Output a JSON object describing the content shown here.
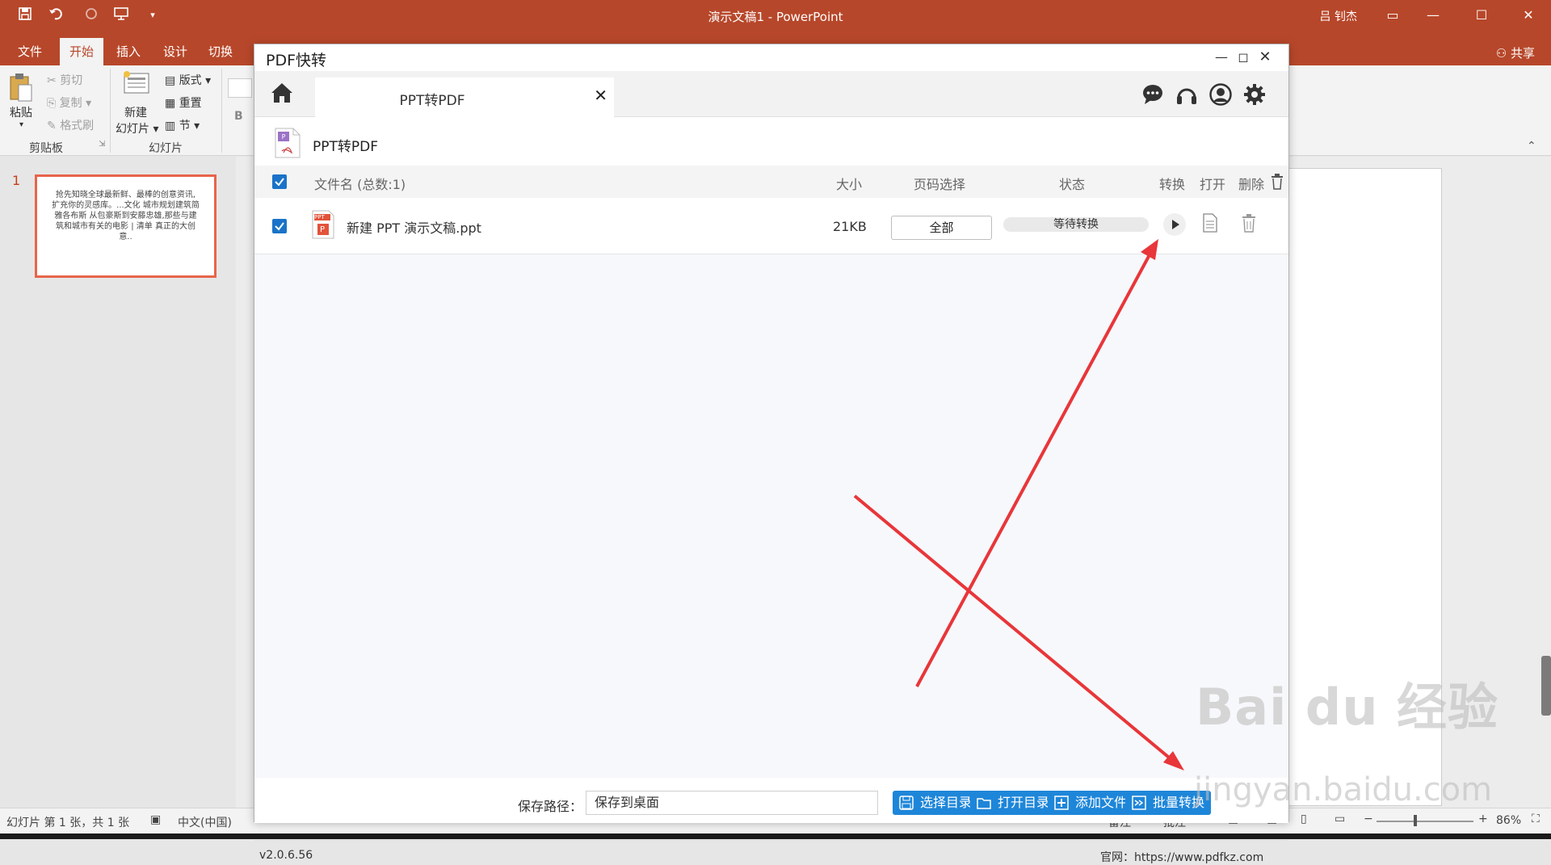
{
  "app": {
    "title": "演示文稿1 - PowerPoint",
    "user": "吕 钊杰",
    "share": "共享",
    "tabs": [
      "文件",
      "开始",
      "插入",
      "设计",
      "切换"
    ],
    "active_tab": "开始"
  },
  "ribbon": {
    "paste": "粘贴",
    "cut": "剪切",
    "copy": "复制",
    "format_painter": "格式刷",
    "clipboard_label": "剪贴板",
    "new_slide_1": "新建",
    "new_slide_2": "幻灯片",
    "layout": "版式",
    "reset": "重置",
    "section": "节",
    "slides_label": "幻灯片",
    "bold": "B"
  },
  "slides": {
    "number": "1",
    "thumb_text": "抢先知晓全球最新鲜、最棒的创意资讯,扩充你的灵感库。...文化 城市规划建筑简 雅各布斯 从包豪斯到安藤忠雄,那些与建筑和城市有关的电影 | 清单 真正的大创意.."
  },
  "statusbar": {
    "slide_info": "幻灯片 第 1 张，共 1 张",
    "language": "中文(中国)",
    "notes": "备注",
    "comments": "批注",
    "zoom": "86%"
  },
  "dialog": {
    "title": "PDF快转",
    "tab_label": "PPT转PDF",
    "section_title": "PPT转PDF",
    "columns": {
      "filename": "文件名 (总数:1)",
      "size": "大小",
      "pages": "页码选择",
      "status": "状态",
      "convert": "转换",
      "open": "打开",
      "delete": "删除"
    },
    "rows": [
      {
        "filename": "新建 PPT 演示文稿.ppt",
        "size": "21KB",
        "pages": "全部",
        "status": "等待转换"
      }
    ],
    "file_icon_label": "PPT",
    "file_icon_letter": "P",
    "save_path_label": "保存路径：",
    "save_path_value": "保存到桌面",
    "buttons": {
      "choose_dir": "选择目录",
      "open_dir": "打开目录",
      "add_file": "添加文件",
      "batch_convert": "批量转换"
    },
    "version": "v2.0.6.56",
    "website": "官网：https://www.pdfkz.com"
  },
  "watermark": {
    "brand": "Bai du 经验",
    "url": "jingyan.baidu.com"
  },
  "colors": {
    "ppt_accent": "#b7472a",
    "button_blue": "#1e86d9",
    "checkbox_blue": "#1a73c8",
    "annotation_red": "#e8363a"
  }
}
